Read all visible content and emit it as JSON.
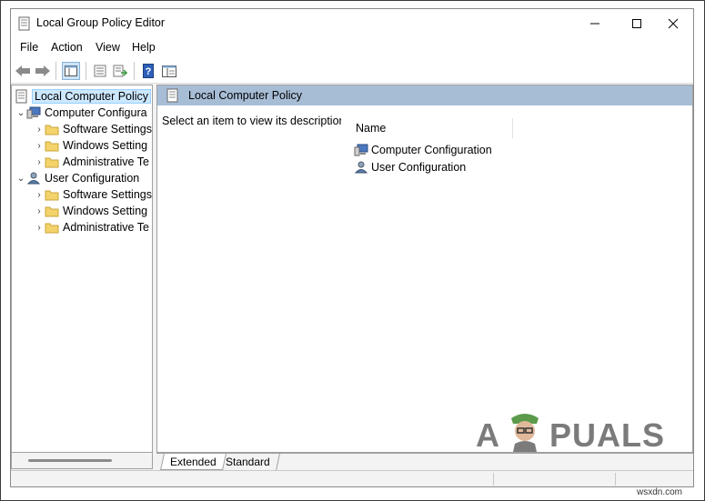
{
  "window": {
    "title": "Local Group Policy Editor",
    "controls": {
      "minimize": "—",
      "maximize": "☐",
      "close": "✕"
    }
  },
  "menu": [
    "File",
    "Action",
    "View",
    "Help"
  ],
  "toolbar": {
    "icons": [
      "back-arrow-icon",
      "forward-arrow-icon",
      "show-hide-tree-icon",
      "properties-icon",
      "export-list-icon",
      "help-icon",
      "extended-view-icon"
    ]
  },
  "tree": {
    "root": "Local Computer Policy",
    "computer_configuration": "Computer Configura",
    "computer_children": [
      "Software Settings",
      "Windows Setting",
      "Administrative Te"
    ],
    "user_configuration": "User Configuration",
    "user_children": [
      "Software Settings",
      "Windows Setting",
      "Administrative Te"
    ]
  },
  "details": {
    "header": "Local Computer Policy",
    "description": "Select an item to view its description.",
    "column_name": "Name",
    "items": [
      "Computer Configuration",
      "User Configuration"
    ]
  },
  "tabs": [
    "Extended",
    "Standard"
  ],
  "watermark": {
    "text_a": "A",
    "text_b": "PUALS"
  },
  "site": "wsxdn.com",
  "colors": {
    "header_band": "#a7bdd6",
    "selection": "#cce8ff",
    "folder": "#f5d36b"
  }
}
